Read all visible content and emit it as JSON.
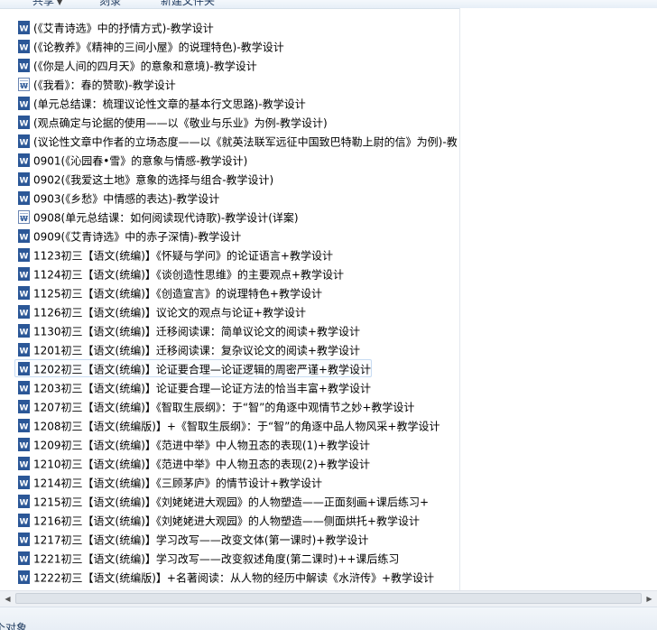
{
  "toolbar": {
    "items": [
      {
        "label": "共享",
        "has_dropdown": true
      },
      {
        "label": "刻录",
        "has_dropdown": false
      },
      {
        "label": "新建文件夹",
        "has_dropdown": false
      }
    ]
  },
  "files": [
    {
      "name": "(《艾青诗选》中的抒情方式)-教学设计",
      "icon": "word-doc-icon"
    },
    {
      "name": "(《论教养》《精神的三间小屋》的说理特色)-教学设计",
      "icon": "word-doc-icon"
    },
    {
      "name": "(《你是人间的四月天》的意象和意境)-教学设计",
      "icon": "word-doc-icon"
    },
    {
      "name": "(《我看》：春的赞歌)-教学设计",
      "icon": "word-doc-legacy-icon"
    },
    {
      "name": "(单元总结课：梳理议论性文章的基本行文思路)-教学设计",
      "icon": "word-doc-icon"
    },
    {
      "name": "(观点确定与论据的使用——以《敬业与乐业》为例-教学设计)",
      "icon": "word-doc-icon"
    },
    {
      "name": "(议论性文章中作者的立场态度——以《就英法联军远征中国致巴特勒上尉的信》为例)-教",
      "icon": "word-doc-icon"
    },
    {
      "name": "0901(《沁园春•雪》的意象与情感-教学设计)",
      "icon": "word-doc-icon"
    },
    {
      "name": "0902(《我爱这土地》意象的选择与组合-教学设计)",
      "icon": "word-doc-icon"
    },
    {
      "name": "0903(《乡愁》中情感的表达)-教学设计",
      "icon": "word-doc-icon"
    },
    {
      "name": "0908(单元总结课：如何阅读现代诗歌)-教学设计(详案)",
      "icon": "word-doc-legacy-icon"
    },
    {
      "name": "0909(《艾青诗选》中的赤子深情)-教学设计",
      "icon": "word-doc-icon"
    },
    {
      "name": "1123初三【语文(统编)】《怀疑与学问》的论证语言+教学设计",
      "icon": "word-doc-icon"
    },
    {
      "name": "1124初三【语文(统编)】《谈创造性思维》的主要观点+教学设计",
      "icon": "word-doc-icon"
    },
    {
      "name": "1125初三【语文(统编)】《创造宣言》的说理特色+教学设计",
      "icon": "word-doc-icon"
    },
    {
      "name": "1126初三【语文(统编)】议论文的观点与论证+教学设计",
      "icon": "word-doc-icon"
    },
    {
      "name": "1130初三【语文(统编)】迁移阅读课：简单议论文的阅读+教学设计",
      "icon": "word-doc-icon"
    },
    {
      "name": "1201初三【语文(统编)】迁移阅读课：复杂议论文的阅读+教学设计",
      "icon": "word-doc-icon"
    },
    {
      "name": "1202初三【语文(统编)】论证要合理—论证逻辑的周密严谨+教学设计",
      "icon": "word-doc-icon",
      "focused": true
    },
    {
      "name": "1203初三【语文(统编)】论证要合理—论证方法的恰当丰富+教学设计",
      "icon": "word-doc-icon"
    },
    {
      "name": "1207初三【语文(统编)】《智取生辰纲》：于“智”的角逐中观情节之妙+教学设计",
      "icon": "word-doc-icon"
    },
    {
      "name": "1208初三【语文(统编版)】+《智取生辰纲》：于“智”的角逐中品人物风采+教学设计",
      "icon": "word-doc-icon"
    },
    {
      "name": "1209初三【语文(统编)】《范进中举》中人物丑态的表现(1)+教学设计",
      "icon": "word-doc-icon"
    },
    {
      "name": "1210初三【语文(统编)】《范进中举》中人物丑态的表现(2)+教学设计",
      "icon": "word-doc-icon"
    },
    {
      "name": "1214初三【语文(统编)】《三顾茅庐》的情节设计+教学设计",
      "icon": "word-doc-icon"
    },
    {
      "name": "1215初三【语文(统编)】《刘姥姥进大观园》的人物塑造——正面刻画+课后练习+",
      "icon": "word-doc-icon"
    },
    {
      "name": "1216初三【语文(统编)】《刘姥姥进大观园》的人物塑造——侧面烘托+教学设计",
      "icon": "word-doc-icon"
    },
    {
      "name": "1217初三【语文(统编)】学习改写——改变文体(第一课时)+教学设计",
      "icon": "word-doc-icon"
    },
    {
      "name": "1221初三【语文(统编)】学习改写——改变叙述角度(第二课时)++课后练习",
      "icon": "word-doc-icon"
    },
    {
      "name": "1222初三【语文(统编版)】+名著阅读：从人物的经历中解读《水浒传》+教学设计",
      "icon": "word-doc-icon"
    }
  ],
  "statusbar": {
    "text": "个对象"
  },
  "colors": {
    "word_blue": "#2b5797",
    "focus_border": "#c7dbf2"
  }
}
